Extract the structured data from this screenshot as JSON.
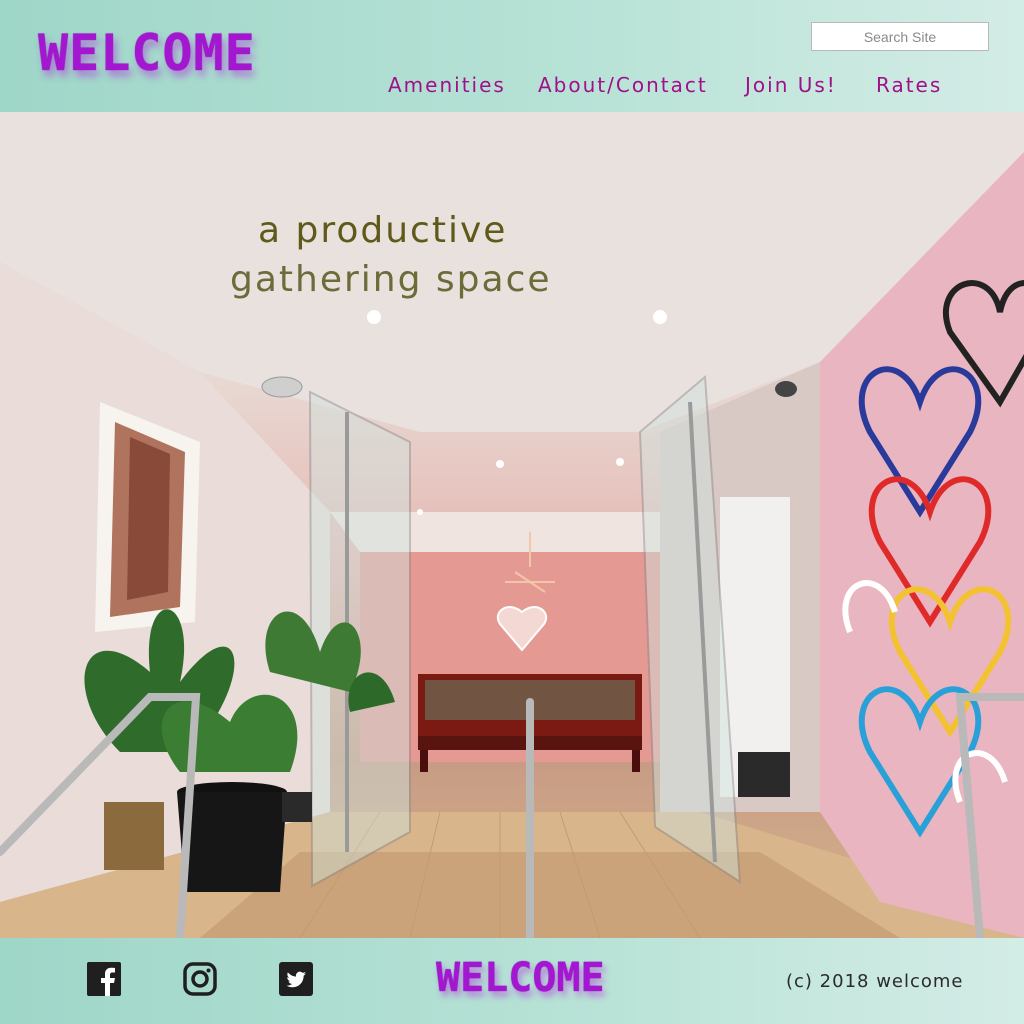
{
  "header": {
    "logo_text": "WELCOME",
    "search_placeholder": "Search Site",
    "nav": [
      {
        "label": "Amenities"
      },
      {
        "label": "About/Contact"
      },
      {
        "label": "Join Us!"
      },
      {
        "label": "Rates"
      }
    ]
  },
  "hero": {
    "tagline_line1": "a productive",
    "tagline_line2": "gathering space"
  },
  "footer": {
    "social": [
      {
        "icon": "facebook-icon"
      },
      {
        "icon": "instagram-icon"
      },
      {
        "icon": "twitter-icon"
      }
    ],
    "logo_text": "WELCOME",
    "copyright": "(c) 2018 welcome"
  },
  "colors": {
    "brand_purple": "#a317d1",
    "nav_magenta": "#a0108a",
    "header_teal": "#b7e2d6",
    "tagline_olive": "#5f5a1a"
  }
}
